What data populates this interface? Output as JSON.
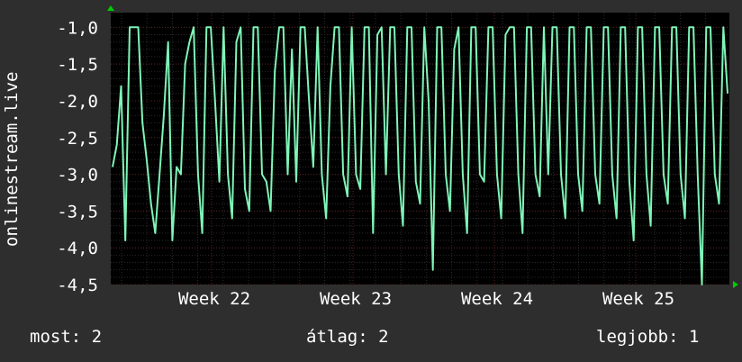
{
  "chart_data": {
    "type": "line",
    "ylabel": "onlinestream.live",
    "ylim": [
      -4.5,
      -0.8
    ],
    "y_ticks": [
      "-1,0",
      "-1,5",
      "-2,0",
      "-2,5",
      "-3,0",
      "-3,5",
      "-4,0",
      "-4,5"
    ],
    "x_ticks": [
      "Week 22",
      "Week 23",
      "Week 24",
      "Week 25"
    ],
    "grid": true,
    "colors": {
      "line": "#7ff5b8",
      "background": "#000000",
      "grid": "#3a3a3a",
      "axis_arrow": "#00cc00"
    },
    "series": [
      {
        "values": [
          -2.9,
          -2.6,
          -1.8,
          -3.9,
          -1.0,
          -1.0,
          -1.0,
          -2.3,
          -2.8,
          -3.4,
          -3.8,
          -3.0,
          -2.2,
          -1.2,
          -3.9,
          -2.9,
          -3.0,
          -1.5,
          -1.2,
          -1.0,
          -3.0,
          -3.8,
          -1.0,
          -1.0,
          -2.0,
          -3.1,
          -1.0,
          -3.0,
          -3.6,
          -1.2,
          -1.0,
          -3.2,
          -3.5,
          -1.0,
          -1.0,
          -3.0,
          -3.1,
          -3.5,
          -1.6,
          -1.0,
          -1.0,
          -3.0,
          -1.3,
          -3.1,
          -1.0,
          -1.0,
          -2.0,
          -2.9,
          -1.0,
          -3.0,
          -3.6,
          -1.8,
          -1.0,
          -1.0,
          -3.0,
          -3.3,
          -1.0,
          -3.0,
          -3.2,
          -1.0,
          -1.0,
          -3.8,
          -1.1,
          -1.0,
          -3.0,
          -1.0,
          -1.0,
          -3.0,
          -3.7,
          -1.0,
          -1.0,
          -3.1,
          -3.4,
          -1.0,
          -2.0,
          -4.3,
          -1.0,
          -1.0,
          -3.0,
          -3.5,
          -1.3,
          -1.0,
          -3.0,
          -3.8,
          -1.0,
          -1.0,
          -3.0,
          -3.1,
          -1.0,
          -1.0,
          -3.0,
          -3.6,
          -1.1,
          -1.0,
          -1.0,
          -3.0,
          -3.8,
          -1.0,
          -1.0,
          -3.0,
          -3.3,
          -1.0,
          -3.0,
          -1.0,
          -1.0,
          -3.0,
          -3.6,
          -1.0,
          -1.0,
          -3.0,
          -3.5,
          -1.0,
          -1.0,
          -3.0,
          -3.4,
          -1.0,
          -1.0,
          -3.0,
          -3.6,
          -1.0,
          -1.0,
          -3.1,
          -3.9,
          -1.0,
          -1.0,
          -3.0,
          -3.7,
          -1.0,
          -1.0,
          -3.0,
          -3.4,
          -1.0,
          -1.0,
          -3.0,
          -3.6,
          -1.0,
          -1.0,
          -3.0,
          -4.5,
          -1.0,
          -1.0,
          -3.0,
          -3.4,
          -1.0,
          -1.9
        ]
      }
    ],
    "footer": {
      "now": "most: 2",
      "avg": "átlag: 2",
      "best": "legjobb: 1"
    }
  }
}
